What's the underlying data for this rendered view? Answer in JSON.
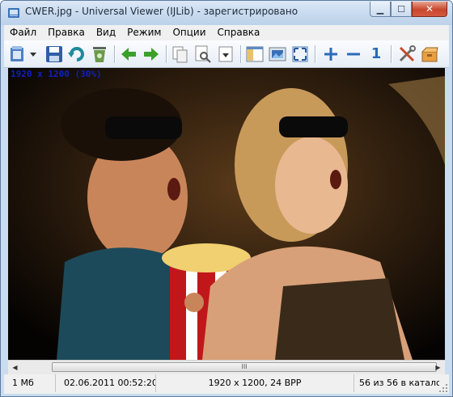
{
  "window": {
    "title": "CWER.jpg - Universal Viewer (IJLib) - зарегистрировано"
  },
  "caption": {
    "minimize": "▁",
    "maximize": "☐",
    "close": "✕"
  },
  "menu": [
    "Файл",
    "Правка",
    "Вид",
    "Режим",
    "Опции",
    "Справка"
  ],
  "toolbar": {
    "buttons": [
      {
        "name": "open-icon"
      },
      {
        "name": "dropdown-arrow-icon"
      },
      {
        "name": "save-icon"
      },
      {
        "name": "reload-icon"
      },
      {
        "name": "recycle-bin-icon"
      },
      {
        "name": "prev-file-icon"
      },
      {
        "name": "next-file-icon"
      },
      {
        "name": "copy-icon"
      },
      {
        "name": "find-icon"
      },
      {
        "name": "goto-icon"
      },
      {
        "name": "panel-icon"
      },
      {
        "name": "image-icon"
      },
      {
        "name": "fullscreen-icon"
      },
      {
        "name": "zoom-in-icon"
      },
      {
        "name": "zoom-out-icon"
      },
      {
        "name": "zoom-original-icon"
      },
      {
        "name": "options-icon"
      },
      {
        "name": "plugins-icon"
      }
    ],
    "zoom_original_label": "1"
  },
  "image": {
    "overlay": "1920 x 1200 (30%)"
  },
  "scroll": {
    "thumb_grip": "III"
  },
  "status": {
    "size": "1 Мб",
    "date": "02.06.2011 00:52:20",
    "dims": "1920 x 1200, 24 BPP",
    "position": "56 из 56 в катало"
  },
  "colors": {
    "accent": "#1020c0",
    "green_arrow": "#3aa02a"
  }
}
